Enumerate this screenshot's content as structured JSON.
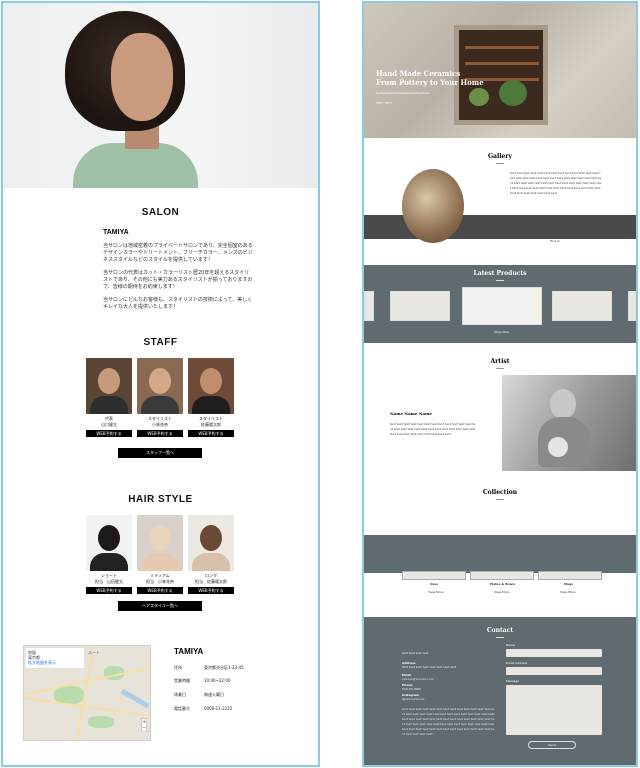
{
  "left": {
    "salon": {
      "title": "SALON",
      "name": "TAMIYA",
      "paragraphs": [
        "当サロンは地域密着のプライベートサロンであり、完全個室のあるデザインカラーやトリートメント、ブリーチカラー、メンズのビジネススタイルなどのスタイルを提供しています！",
        "当サロンの代表はカット・カラーリスト歴20年を超えるスタイリストであり、その他にも実力あるスタイリストが揃っておりますので、皆様の期待をお約束します！",
        "当サロンにどんなお客様も、スタイリストの技術によって、美しくキレイな大人を提供いたします！"
      ]
    },
    "staff": {
      "title": "STAFF",
      "members": [
        {
          "role": "代表",
          "name": "山口健太",
          "button": "WEB予約する"
        },
        {
          "role": "スタイリスト",
          "name": "小林花奈",
          "button": "WEB予約する"
        },
        {
          "role": "スタイリスト",
          "name": "佐藤陽太郎",
          "button": "WEB予約する"
        }
      ],
      "more": "スタッフ一覧へ"
    },
    "hairstyle": {
      "title": "HAIR STYLE",
      "styles": [
        {
          "name": "ショート",
          "stylist": "担当　山田健太",
          "button": "WEB予約する"
        },
        {
          "name": "ミディアム",
          "stylist": "担当　小林花奈",
          "button": "WEB予約する"
        },
        {
          "name": "ロング",
          "stylist": "担当　佐藤陽太郎",
          "button": "WEB予約する"
        }
      ],
      "more": "ヘアスタイル一覧へ"
    },
    "map": {
      "card_title": "地図",
      "card_sub": "東京都",
      "card_link": "拡大地図を表示",
      "route": "ルート"
    },
    "info": {
      "title": "TAMIYA",
      "rows": [
        {
          "label": "住所",
          "value": "東京都渋谷区1-23-45"
        },
        {
          "label": "営業時間",
          "value": "10:00~22:00"
        },
        {
          "label": "休業日",
          "value": "毎週火曜日"
        },
        {
          "label": "電話番号",
          "value": "0000-11-2222"
        }
      ]
    }
  },
  "right": {
    "hero": {
      "title_line1": "Hand Made Ceramics",
      "title_line2": "From Pottery to Your Home",
      "sub": "texttexttexttexttexttexttexttexttext",
      "link": "TEXT TEXT"
    },
    "gallery": {
      "title": "Gallery",
      "text": "text text text text text text text text text text text text text text text text text text text text text text text text text text text text text text text text text text text text text text text text text text text text text text text text text text text text text text text text text text text text",
      "link": "Find In"
    },
    "products": {
      "title": "Latest Products",
      "link": "Shop Now"
    },
    "artist": {
      "title": "Artist",
      "name": "Name Name Name",
      "text": "text text text text text text text text text text text text text text text text text text text text text text text text text text text text text text text text text text"
    },
    "collection": {
      "title": "Collection",
      "items": [
        {
          "name": "Vase",
          "link": "View More"
        },
        {
          "name": "Plates & Bowls",
          "link": "View More"
        },
        {
          "name": "Mugs",
          "link": "View More"
        }
      ]
    },
    "contact": {
      "title": "Contact",
      "intro": "text text text text",
      "address_label": "Address",
      "address_value": "Text text text text text text text text",
      "email_label": "Email",
      "email_value": "xxxxxx@xxxxxx.com",
      "phone_label": "Phone",
      "phone_value": "000-00-0000",
      "insta_label": "Instagram",
      "insta_value": "@xxxxxxxxxxx",
      "body": "text text text text text text text text text text text text text text text text text text text text text text text text text text text text text text text text text text text text text text text text text text text text text text text text text text text text text text text text text text text text text text text text text text text text text text text text",
      "name_field": "Name",
      "email_field": "Email Address",
      "message_field": "Message",
      "send": "Send"
    }
  }
}
